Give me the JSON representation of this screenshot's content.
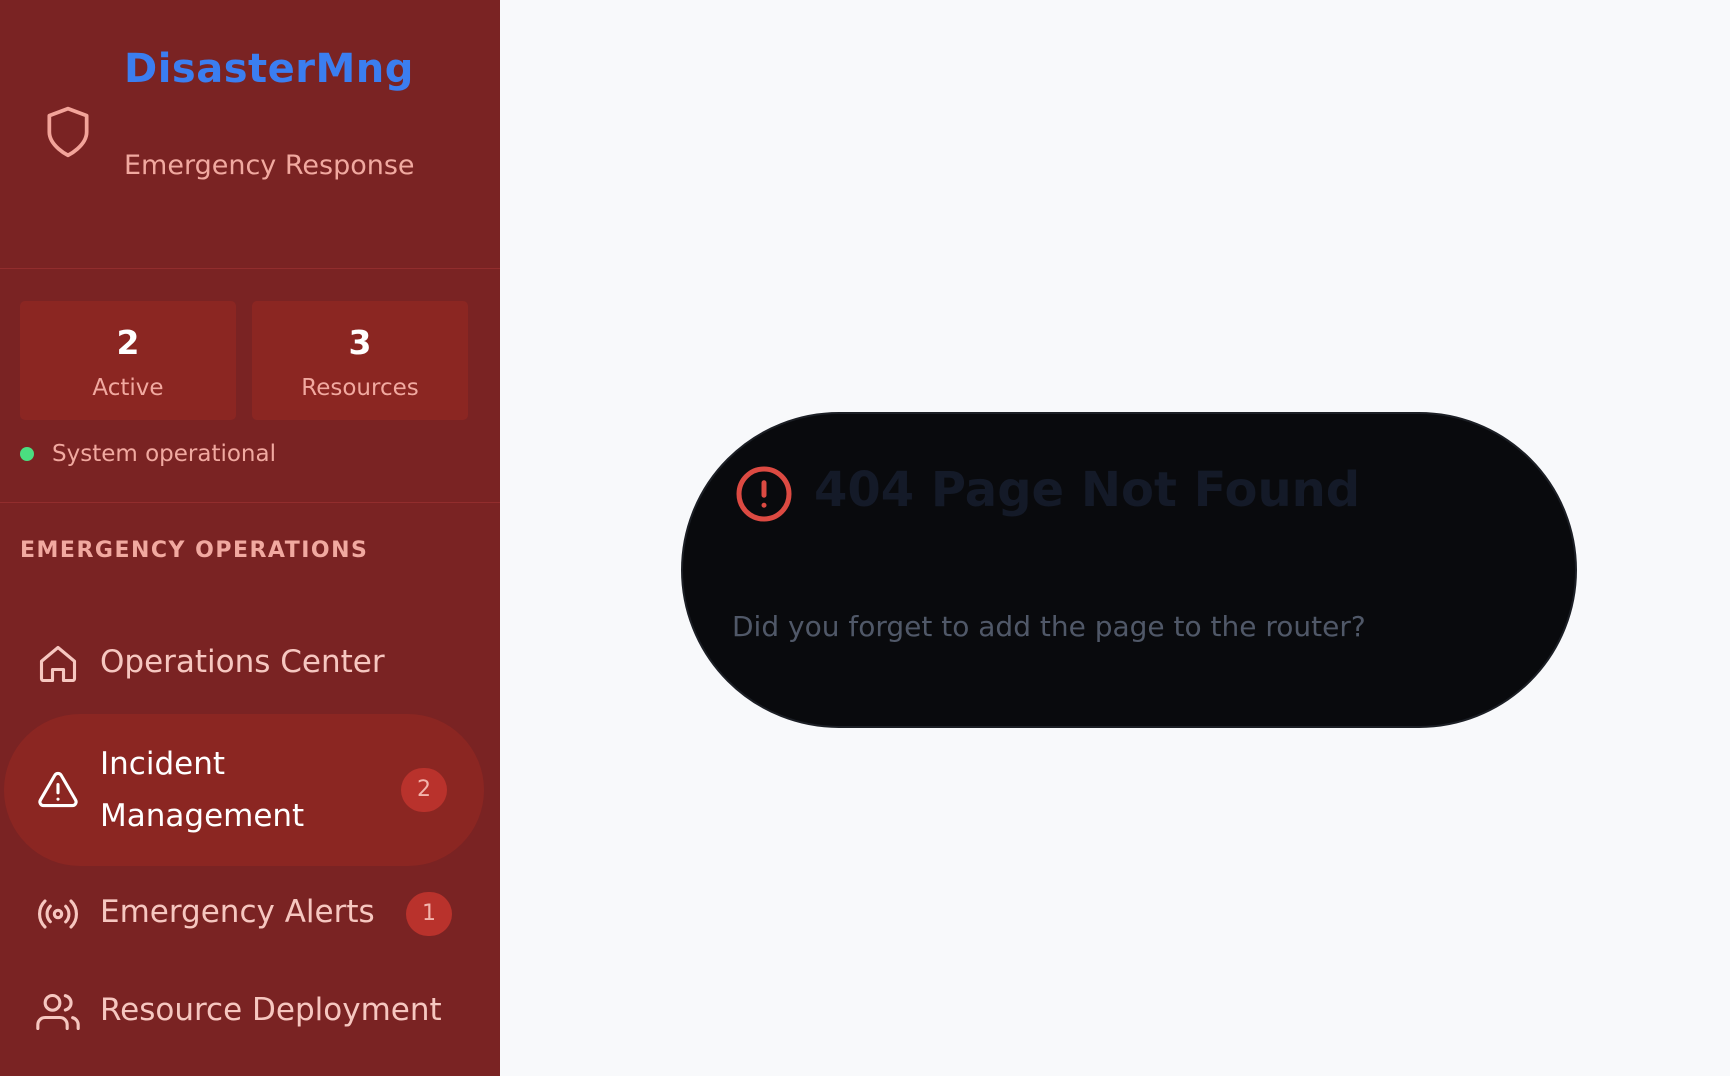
{
  "brand": {
    "title": "DisasterMng",
    "subtitle": "Emergency Response",
    "icon": "shield-icon"
  },
  "stats": [
    {
      "value": "2",
      "label": "Active"
    },
    {
      "value": "3",
      "label": "Resources"
    }
  ],
  "status": {
    "text": "System operational",
    "color": "#4ade80"
  },
  "nav": {
    "section_title": "EMERGENCY OPERATIONS",
    "items": [
      {
        "label": "Operations Center",
        "icon": "home-icon",
        "active": false,
        "badge": null
      },
      {
        "label": "Incident Management",
        "icon": "alert-triangle-icon",
        "active": true,
        "badge": "2"
      },
      {
        "label": "Emergency Alerts",
        "icon": "radio-broadcast-icon",
        "active": false,
        "badge": "1"
      },
      {
        "label": "Resource Deployment",
        "icon": "users-icon",
        "active": false,
        "badge": null
      }
    ]
  },
  "not_found": {
    "title": "404 Page Not Found",
    "message": "Did you forget to add the page to the router?",
    "icon": "alert-circle-icon"
  },
  "colors": {
    "sidebar_bg": "#7a2323",
    "brand_accent": "#3b7ef0",
    "card_bg": "#8b2622",
    "badge_bg": "#b9322c",
    "error_accent": "#dc4a42",
    "page_bg": "#f8f9fb"
  }
}
